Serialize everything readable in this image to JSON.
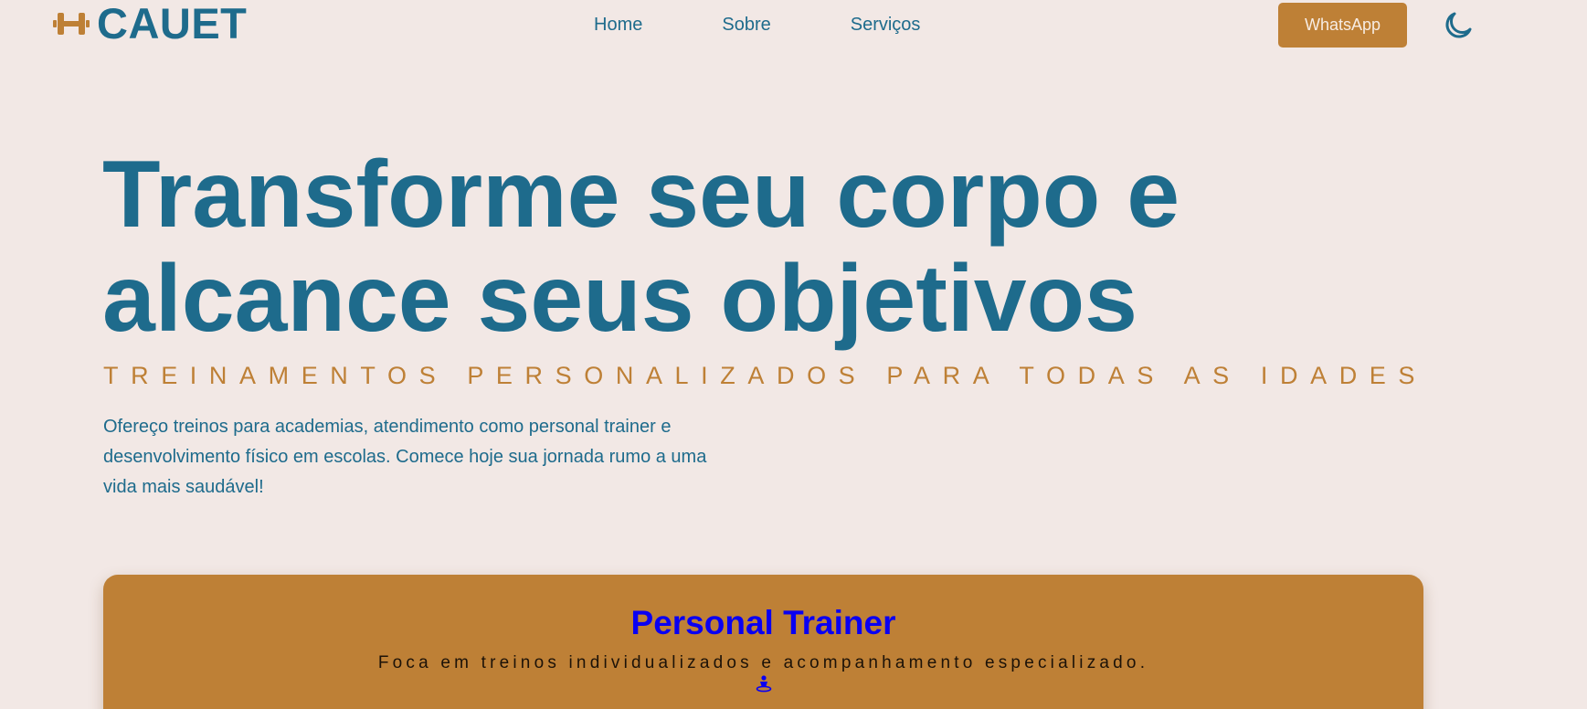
{
  "header": {
    "brand": "CAUET",
    "logo_icon": "dumbbell-icon",
    "nav": [
      {
        "label": "Home"
      },
      {
        "label": "Sobre"
      },
      {
        "label": "Serviços"
      }
    ],
    "whatsapp_label": "WhatsApp",
    "theme_toggle_icon": "moon-icon"
  },
  "hero": {
    "title": "Transforme seu corpo e alcance seus objetivos",
    "subtitle": "TREINAMENTOS PERSONALIZADOS PARA TODAS AS IDADES",
    "text": "Ofereço treinos para academias, atendimento como personal trainer e desenvolvimento físico em escolas. Comece hoje sua jornada rumo a uma vida mais saudável!"
  },
  "services": {
    "card": {
      "title": "Personal Trainer",
      "description": "Foca em treinos individualizados e acompanhamento especializado.",
      "icon": "person-icon"
    }
  },
  "colors": {
    "background": "#f2e8e5",
    "primary": "#1e6b8c",
    "accent": "#be8036",
    "card_title": "#0a00f2"
  }
}
